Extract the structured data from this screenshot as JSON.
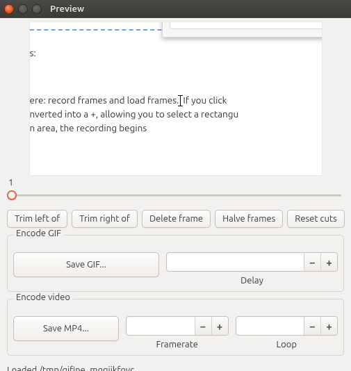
{
  "window": {
    "title": "Preview"
  },
  "preview": {
    "line1": "s:",
    "line2a": "ere: record frames and load frames.",
    "line2b": "If you click ",
    "line3": "nverted into a +, allowing you to select a rectangu",
    "line4": "n area, the recording begins"
  },
  "slider": {
    "label": "1"
  },
  "buttons": {
    "trim_left": "Trim left of",
    "trim_right": "Trim right of",
    "delete_frame": "Delete frame",
    "halve_frames": "Halve frames",
    "reset_cuts": "Reset cuts"
  },
  "encode_gif": {
    "legend": "Encode GIF",
    "save": "Save GIF...",
    "delay_label": "Delay"
  },
  "encode_video": {
    "legend": "Encode video",
    "save": "Save MP4...",
    "framerate_label": "Framerate",
    "loop_label": "Loop"
  },
  "status": "Loaded /tmp/gifine_mgqiikfovc"
}
